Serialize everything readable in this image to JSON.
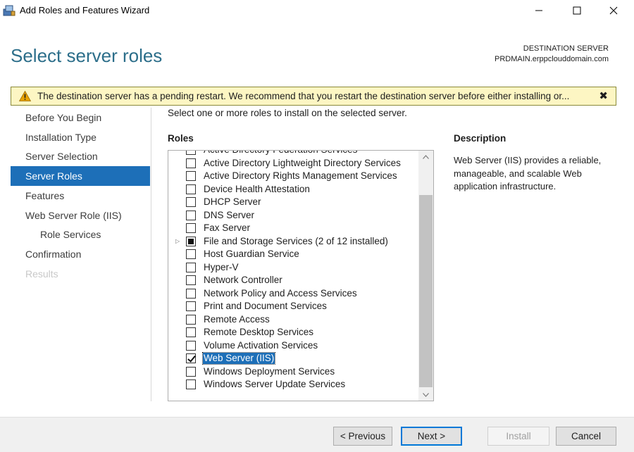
{
  "window": {
    "title": "Add Roles and Features Wizard",
    "icon": "server-manager-icon",
    "controls": [
      "minimize-icon",
      "maximize-icon",
      "close-icon"
    ]
  },
  "header": {
    "page_title": "Select server roles",
    "destination_label": "DESTINATION SERVER",
    "destination_server": "PRDMAIN.erppclouddomain.com"
  },
  "warning": {
    "icon": "warning-triangle-icon",
    "text": "The destination server has a pending restart. We recommend that you restart the destination server before either installing or...",
    "close_label": "✖"
  },
  "nav": {
    "items": [
      {
        "label": "Before You Begin",
        "state": "normal"
      },
      {
        "label": "Installation Type",
        "state": "normal"
      },
      {
        "label": "Server Selection",
        "state": "normal"
      },
      {
        "label": "Server Roles",
        "state": "active"
      },
      {
        "label": "Features",
        "state": "normal"
      },
      {
        "label": "Web Server Role (IIS)",
        "state": "normal"
      },
      {
        "label": "Role Services",
        "state": "sub"
      },
      {
        "label": "Confirmation",
        "state": "normal"
      },
      {
        "label": "Results",
        "state": "disabled"
      }
    ]
  },
  "main": {
    "instruction": "Select one or more roles to install on the selected server.",
    "roles_label": "Roles",
    "roles": [
      {
        "label": "Active Directory Federation Services",
        "state": "unchecked",
        "partial": true
      },
      {
        "label": "Active Directory Lightweight Directory Services",
        "state": "unchecked"
      },
      {
        "label": "Active Directory Rights Management Services",
        "state": "unchecked"
      },
      {
        "label": "Device Health Attestation",
        "state": "unchecked"
      },
      {
        "label": "DHCP Server",
        "state": "unchecked"
      },
      {
        "label": "DNS Server",
        "state": "unchecked"
      },
      {
        "label": "Fax Server",
        "state": "unchecked"
      },
      {
        "label": "File and Storage Services (2 of 12 installed)",
        "state": "indeterminate",
        "expandable": true
      },
      {
        "label": "Host Guardian Service",
        "state": "unchecked"
      },
      {
        "label": "Hyper-V",
        "state": "unchecked"
      },
      {
        "label": "Network Controller",
        "state": "unchecked"
      },
      {
        "label": "Network Policy and Access Services",
        "state": "unchecked"
      },
      {
        "label": "Print and Document Services",
        "state": "unchecked"
      },
      {
        "label": "Remote Access",
        "state": "unchecked"
      },
      {
        "label": "Remote Desktop Services",
        "state": "unchecked"
      },
      {
        "label": "Volume Activation Services",
        "state": "unchecked"
      },
      {
        "label": "Web Server (IIS)",
        "state": "checked",
        "selected": true
      },
      {
        "label": "Windows Deployment Services",
        "state": "unchecked"
      },
      {
        "label": "Windows Server Update Services",
        "state": "unchecked"
      }
    ],
    "description_label": "Description",
    "description_text": "Web Server (IIS) provides a reliable, manageable, and scalable Web application infrastructure."
  },
  "footer": {
    "previous_label": "< Previous",
    "next_label": "Next >",
    "install_label": "Install",
    "cancel_label": "Cancel"
  },
  "colors": {
    "accent": "#1d6fb8",
    "title": "#2c6e8a",
    "warning_bg": "#fdf6c3"
  }
}
